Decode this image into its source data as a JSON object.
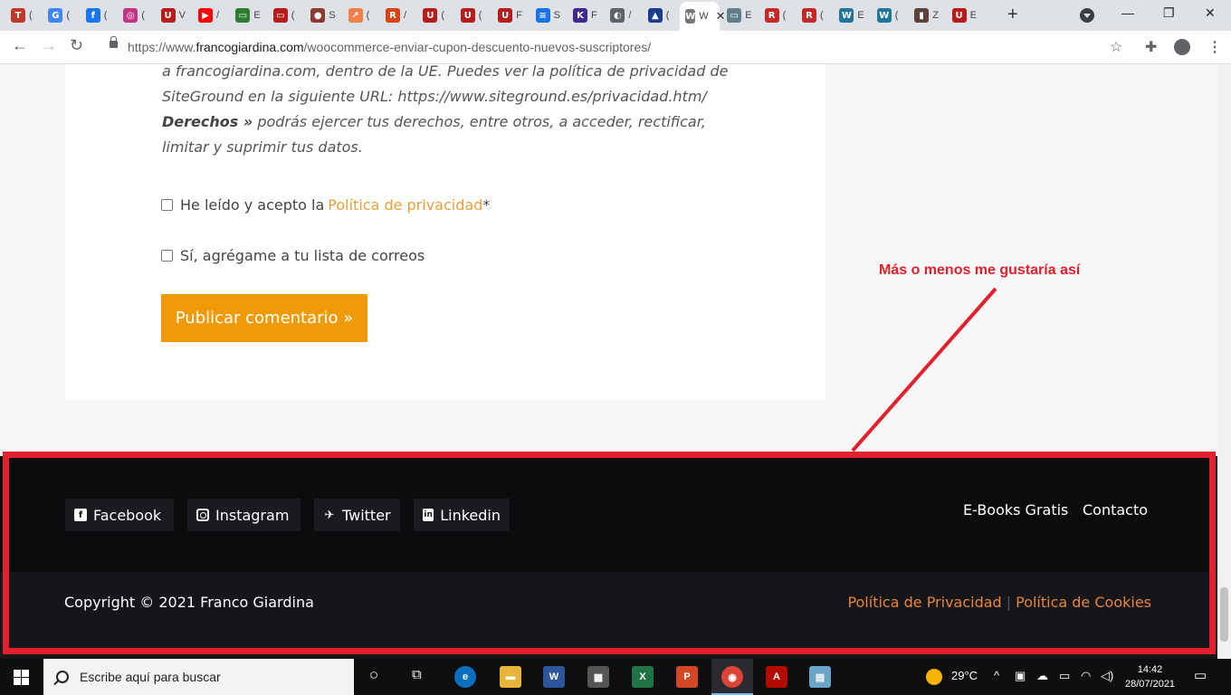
{
  "browser": {
    "tabs": [
      {
        "glyph": "T",
        "color": "#c0392b",
        "label": "("
      },
      {
        "glyph": "G",
        "color": "#4285f4",
        "label": "("
      },
      {
        "glyph": "f",
        "color": "#1877f2",
        "label": "("
      },
      {
        "glyph": "◎",
        "color": "#c13584",
        "label": "("
      },
      {
        "glyph": "U",
        "color": "#b71c1c",
        "label": "V"
      },
      {
        "glyph": "▶",
        "color": "#ff0000",
        "label": "/"
      },
      {
        "glyph": "▭",
        "color": "#2e7d32",
        "label": "E"
      },
      {
        "glyph": "▭",
        "color": "#b71c1c",
        "label": "("
      },
      {
        "glyph": "●",
        "color": "#8d3b2f",
        "label": "S"
      },
      {
        "glyph": "↗",
        "color": "#f07f4a",
        "label": "("
      },
      {
        "glyph": "R",
        "color": "#d84315",
        "label": "/"
      },
      {
        "glyph": "U",
        "color": "#b71c1c",
        "label": "("
      },
      {
        "glyph": "U",
        "color": "#b71c1c",
        "label": "("
      },
      {
        "glyph": "U",
        "color": "#b71c1c",
        "label": "F"
      },
      {
        "glyph": "≡",
        "color": "#1a73e8",
        "label": "S"
      },
      {
        "glyph": "K",
        "color": "#3f2a8c",
        "label": "F"
      },
      {
        "glyph": "◐",
        "color": "#5f6368",
        "label": "/"
      },
      {
        "glyph": "▲",
        "color": "#1a3d8f",
        "label": "("
      },
      {
        "glyph": "W",
        "color": "#777777",
        "label": "W",
        "active": true
      },
      {
        "glyph": "▭",
        "color": "#607d8b",
        "label": "E"
      },
      {
        "glyph": "R",
        "color": "#c62828",
        "label": "("
      },
      {
        "glyph": "R",
        "color": "#c62828",
        "label": "("
      },
      {
        "glyph": "W",
        "color": "#21759b",
        "label": "E"
      },
      {
        "glyph": "W",
        "color": "#21759b",
        "label": "("
      },
      {
        "glyph": "▮",
        "color": "#5d4037",
        "label": "Z"
      },
      {
        "glyph": "U",
        "color": "#b71c1c",
        "label": "E"
      }
    ],
    "url_prefix": "https://www.",
    "url_host": "francogiardina.com",
    "url_path": "/woocommerce-enviar-cupon-descuento-nuevos-suscriptores/"
  },
  "content": {
    "line1": "a francogiardina.com, dentro de la UE. Puedes ver la política de privacidad de",
    "line2": "SiteGround en la siguiente URL: https://www.siteground.es/privacidad.htm/",
    "rights_label": "Derechos »",
    "rights_text": " podrás ejercer tus derechos, entre otros, a acceder, rectificar,",
    "line4": "limitar y suprimir tus datos.",
    "privacy_check_text": "He leído y acepto la",
    "privacy_link": "Política de privacidad",
    "required_mark": " *",
    "newsletter_check_text": "Sí, agrégame a tu lista de correos",
    "submit_label": "Publicar comentario »"
  },
  "annotation": {
    "text": "Más o menos me gustaría así",
    "color": "#e3202b"
  },
  "footer": {
    "social": [
      {
        "name": "facebook",
        "label": "Facebook",
        "glyph": "f"
      },
      {
        "name": "instagram",
        "label": "Instagram",
        "glyph": ""
      },
      {
        "name": "twitter",
        "label": "Twitter",
        "glyph": "🐦"
      },
      {
        "name": "linkedin",
        "label": "Linkedin",
        "glyph": "in"
      }
    ],
    "links": [
      "E-Books Gratis",
      "Contacto"
    ],
    "copyright": "Copyright © 2021 Franco Giardina",
    "privacy_policy": "Política de Privacidad",
    "separator": "|",
    "cookie_policy": "Política de Cookies"
  },
  "taskbar": {
    "search_placeholder": "Escribe aquí para buscar",
    "temperature": "29°C",
    "time": "14:42",
    "date": "28/07/2021"
  }
}
